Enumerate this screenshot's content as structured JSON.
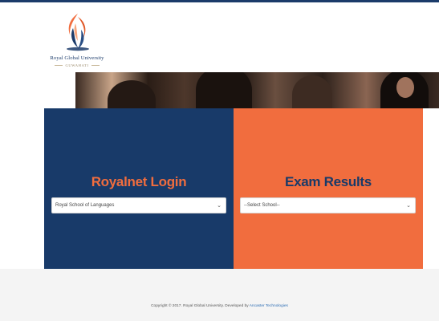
{
  "header": {
    "logo_name": "Royal Global University",
    "logo_sub": "GUWAHATI"
  },
  "panels": {
    "login": {
      "title": "Royalnet Login",
      "select_value": "Royal School of Languages"
    },
    "results": {
      "title": "Exam Results",
      "select_value": "--Select School--"
    }
  },
  "footer": {
    "copyright": "Copyright © 2017. Royal Global University. Developed by ",
    "developer_link": "Ancaster Technologies"
  },
  "icons": {
    "logo": "flame-emblem-icon",
    "select_arrow": "chevron-down-icon"
  },
  "colors": {
    "navy": "#183a69",
    "orange": "#f16d3e",
    "footer_bg": "#f4f4f4"
  }
}
